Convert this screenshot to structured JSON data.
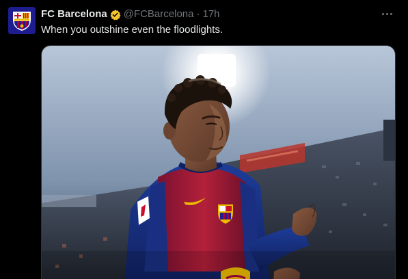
{
  "account": {
    "name": "FC Barcelona",
    "handle": "@FCBarcelona",
    "separator": "·",
    "time": "17h",
    "verified_color": "#F4C530",
    "verified_icon": "verified-badge-icon"
  },
  "tweet": {
    "text": "When you outshine even the floodlights."
  },
  "more_icon": "more-horizontal-icon",
  "media": {
    "type": "photo",
    "subject": "player-in-blaugrana-kit"
  },
  "colors": {
    "background": "#000000",
    "text_primary": "#e7e9ea",
    "text_secondary": "#71767b",
    "crest_blue": "#1d1d8f",
    "crest_red": "#a50044",
    "crest_yellow": "#edbb00"
  }
}
